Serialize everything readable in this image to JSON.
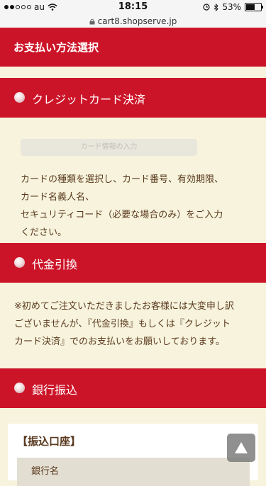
{
  "status_bar": {
    "carrier": "au",
    "time": "18:15",
    "battery_percent": "53%"
  },
  "browser": {
    "url": "cart8.shopserve.jp"
  },
  "header": {
    "title": "お支払い方法選択"
  },
  "payment_methods": [
    {
      "label": "クレジットカード決済",
      "input_placeholder": "カード情報の入力",
      "description_lines": [
        "カードの種類を選択し、カード番号、有効期限、",
        "カード名義人名、",
        "セキュリティコード（必要な場合のみ）をご入力",
        "ください。"
      ]
    },
    {
      "label": "代金引換",
      "description_lines": [
        "※初めてご注文いただきましたお客様には大変申し訳",
        "ございませんが、『代金引換』もしくは『クレジット",
        "カード決済』でのお支払いをお願いしております。"
      ]
    },
    {
      "label": "銀行振込",
      "account_title": "【振込口座】",
      "account_row_label": "銀行名"
    }
  ],
  "colors": {
    "accent": "#cc1428",
    "background": "#f7f3dc",
    "text": "#5a3a1f"
  },
  "icons": [
    "wifi-icon",
    "lock-icon",
    "bluetooth-icon",
    "alarm-icon",
    "battery-icon",
    "radio-dot-icon",
    "arrow-up-icon"
  ]
}
